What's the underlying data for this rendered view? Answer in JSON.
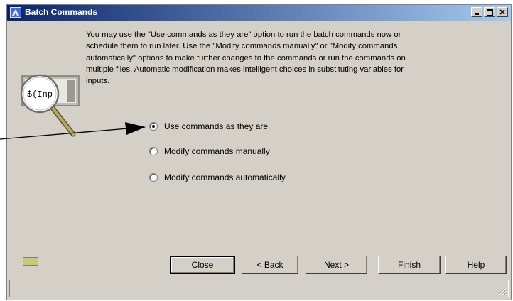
{
  "window": {
    "title": "Batch Commands",
    "icon": "batch-commands-icon",
    "controls": [
      "minimize-icon",
      "maximize-icon",
      "close-icon"
    ]
  },
  "description": "You may use the \"Use commands as they are\" option to run the batch commands now or schedule them to run later. Use the \"Modify commands manually\" or \"Modify commands automatically\" options to make further changes to the commands or run the commands on multiple files. Automatic modification makes intelligent choices in substituting  variables for inputs.",
  "wizard_image": {
    "icon": "magnifier-icon",
    "text": "$(Inp"
  },
  "options": [
    {
      "label": "Use commands as they are",
      "checked": true
    },
    {
      "label": "Modify commands manually",
      "checked": false
    },
    {
      "label": "Modify commands automatically",
      "checked": false
    }
  ],
  "buttons": {
    "close": "Close",
    "back": "< Back",
    "next": "Next >",
    "finish": "Finish",
    "help": "Help"
  },
  "colors": {
    "dialog_face": "#d4d0c8",
    "title_start": "#0a246a",
    "title_end": "#a6caf0",
    "status_led": "#c8c878"
  }
}
